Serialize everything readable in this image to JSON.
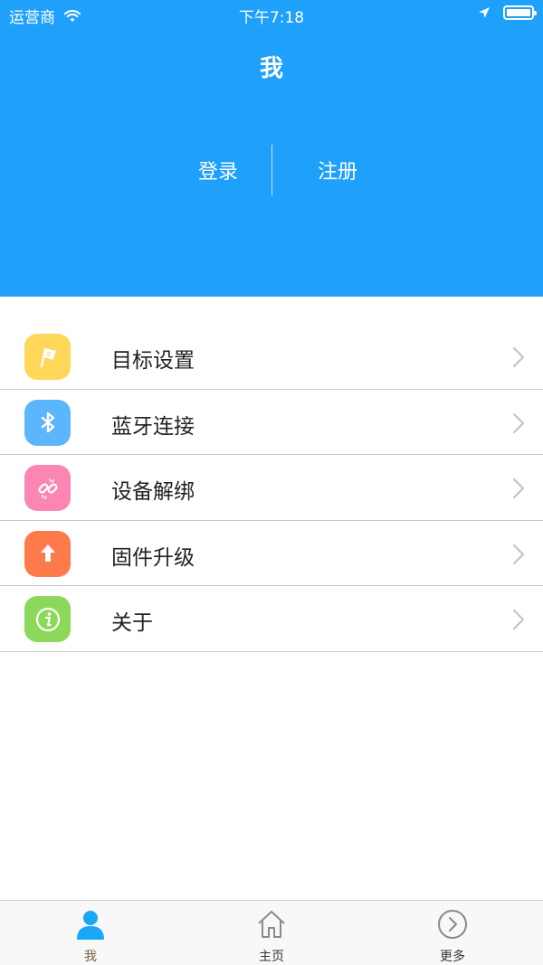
{
  "statusbar": {
    "carrier": "运营商",
    "time": "下午7:18",
    "wifi_icon": "wifi-icon",
    "location_icon": "location-arrow-icon",
    "battery_icon": "battery-icon"
  },
  "header": {
    "title": "我",
    "login_label": "登录",
    "register_label": "注册",
    "background_color": "#1ea0fb"
  },
  "menu": {
    "items": [
      {
        "label": "目标设置",
        "icon": "flag-icon",
        "color": "#ffd75a"
      },
      {
        "label": "蓝牙连接",
        "icon": "bluetooth-icon",
        "color": "#5cb6fb"
      },
      {
        "label": "设备解绑",
        "icon": "unlink-icon",
        "color": "#fb86b3"
      },
      {
        "label": "固件升级",
        "icon": "upload-arrow-icon",
        "color": "#ff7a4a"
      },
      {
        "label": "关于",
        "icon": "info-icon",
        "color": "#8bd85a"
      }
    ]
  },
  "tabbar": {
    "tabs": [
      {
        "label": "我",
        "icon": "person-icon",
        "active": true
      },
      {
        "label": "主页",
        "icon": "home-icon",
        "active": false
      },
      {
        "label": "更多",
        "icon": "chevron-circle-icon",
        "active": false
      }
    ]
  }
}
